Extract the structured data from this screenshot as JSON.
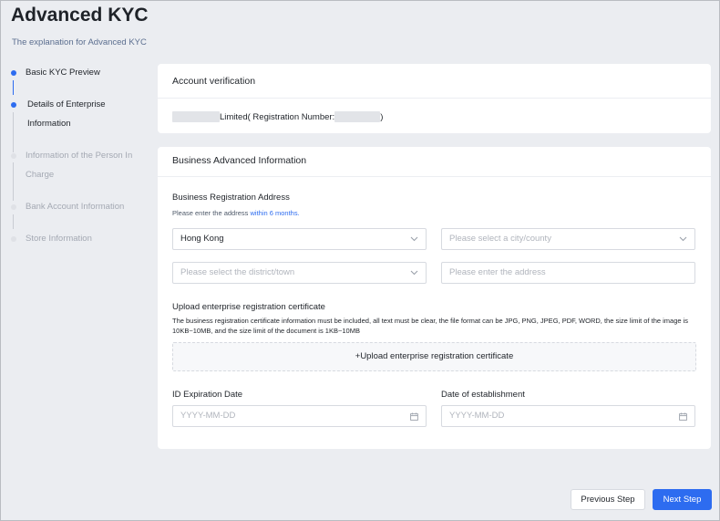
{
  "page": {
    "title": "Advanced KYC",
    "subtitle": "The explanation for Advanced KYC"
  },
  "steps": [
    {
      "line1": "Basic KYC Preview",
      "line2": "",
      "status": "done"
    },
    {
      "line1": "Details of Enterprise",
      "line2": "Information",
      "status": "active"
    },
    {
      "line1": "Information of the Person In",
      "line2": "Charge",
      "status": "todo"
    },
    {
      "line1": "Bank Account Information",
      "line2": "",
      "status": "todo"
    },
    {
      "line1": "Store Information",
      "line2": "",
      "status": "todo"
    }
  ],
  "account": {
    "header": "Account verification",
    "company_suffix": "Limited( Registration Number:",
    "close_paren": ")"
  },
  "business": {
    "header": "Business Advanced Information",
    "address_label": "Business Registration Address",
    "address_hint": "Please enter the address ",
    "address_hint_link": "within 6 months.",
    "region_value": "Hong Kong",
    "city_placeholder": "Please select a city/county",
    "district_placeholder": "Please select the district/town",
    "address_placeholder": "Please enter the address",
    "upload_label": "Upload enterprise registration certificate",
    "upload_desc": "The business registration certificate information must be included, all text must be clear, the file format can be JPG, PNG, JPEG, PDF, WORD, the size limit of the image is 10KB~10MB, and the size limit of the document is 1KB~10MB",
    "upload_button": "+Upload enterprise registration certificate",
    "id_expiration_label": "ID Expiration Date",
    "id_expiration_placeholder": "YYYY-MM-DD",
    "establishment_label": "Date of establishment",
    "establishment_placeholder": "YYYY-MM-DD"
  },
  "footer": {
    "prev": "Previous Step",
    "next": "Next Step"
  },
  "colors": {
    "accent": "#2d6cf0",
    "background": "#ebedf1"
  }
}
